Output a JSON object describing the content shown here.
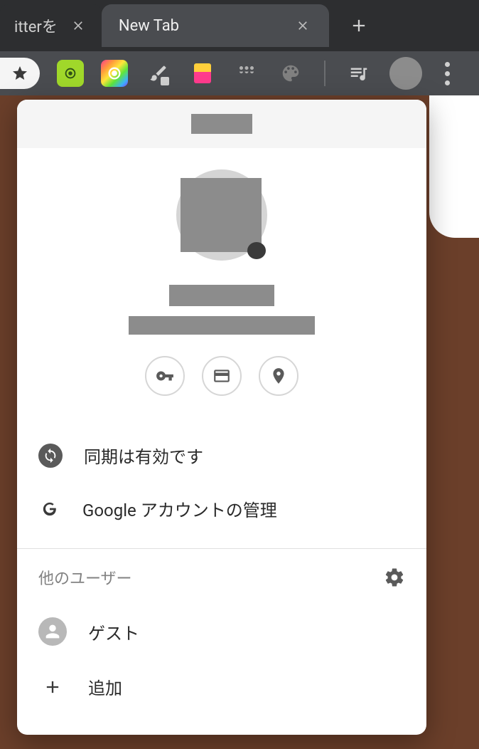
{
  "tabs": {
    "inactive_label": "itterを",
    "active_label": "New Tab"
  },
  "popup": {
    "quick_actions": {
      "passwords": "passwords",
      "payments": "payments",
      "addresses": "addresses"
    },
    "sync_label": "同期は有効です",
    "manage_label": "Google アカウントの管理",
    "other_users_title": "他のユーザー",
    "guest_label": "ゲスト",
    "add_label": "追加"
  }
}
